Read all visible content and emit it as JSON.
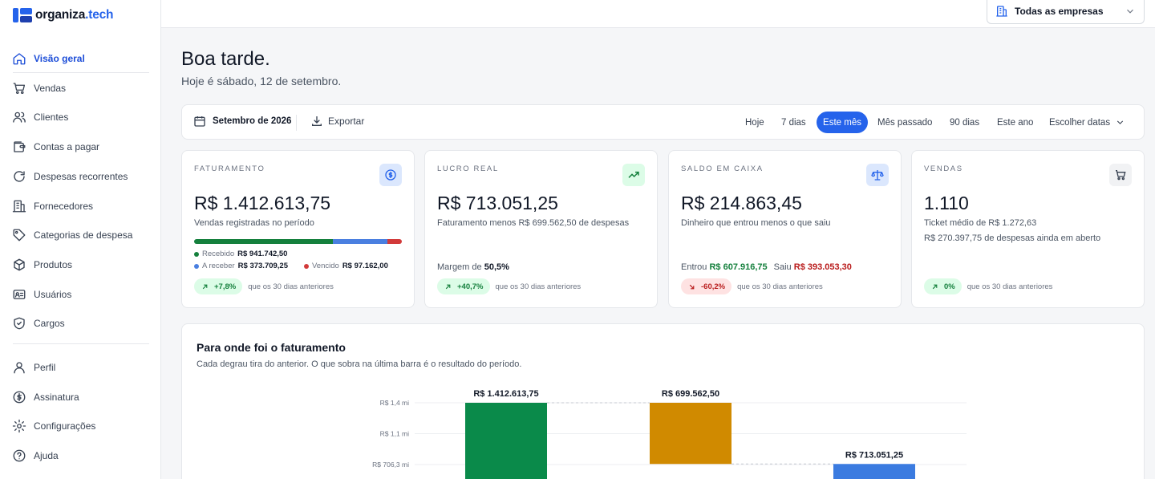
{
  "brand": {
    "name": "organiza",
    "tld": ".tech",
    "accent": "#2563eb"
  },
  "sidebar": {
    "items": [
      {
        "label": "Visão geral",
        "icon": "home-icon",
        "active": true
      },
      {
        "label": "Vendas",
        "icon": "cart-icon"
      },
      {
        "label": "Clientes",
        "icon": "users-icon"
      },
      {
        "label": "Contas a pagar",
        "icon": "wallet-icon"
      },
      {
        "label": "Despesas recorrentes",
        "icon": "refresh-icon"
      },
      {
        "label": "Fornecedores",
        "icon": "building-icon"
      },
      {
        "label": "Categorias de despesa",
        "icon": "tag-icon"
      },
      {
        "label": "Produtos",
        "icon": "box-icon"
      },
      {
        "label": "Usuários",
        "icon": "id-card-icon"
      },
      {
        "label": "Cargos",
        "icon": "shield-icon"
      }
    ],
    "bottom": [
      {
        "label": "Perfil",
        "icon": "user-icon"
      },
      {
        "label": "Assinatura",
        "icon": "dollar-circle-icon"
      },
      {
        "label": "Configurações",
        "icon": "gear-icon"
      },
      {
        "label": "Ajuda",
        "icon": "help-icon"
      }
    ]
  },
  "topbar": {
    "company_select": "Todas as empresas"
  },
  "header": {
    "greeting": "Boa tarde.",
    "date_line": "Hoje é sábado, 12 de setembro."
  },
  "filters": {
    "month": "Setembro de 2026",
    "export": "Exportar",
    "periods": [
      "Hoje",
      "7 dias",
      "Este mês",
      "Mês passado",
      "90 dias",
      "Este ano",
      "Escolher datas"
    ],
    "active_period": "Este mês"
  },
  "cards": {
    "revenue": {
      "title": "FATURAMENTO",
      "value": "R$ 1.412.613,75",
      "sub": "Vendas registradas no período",
      "legend": {
        "received_label": "Recebido",
        "received": "R$ 941.742,50",
        "receivable_label": "A receber",
        "receivable": "R$ 373.709,25",
        "overdue_label": "Vencido",
        "overdue": "R$ 97.162,00"
      },
      "bar_shares": [
        0.6667,
        0.2646,
        0.0688
      ],
      "bar_colors": [
        "#15803d",
        "#4a7fe0",
        "#d23a3a"
      ],
      "change": "+7,8%",
      "compare": "que os 30 dias anteriores"
    },
    "profit": {
      "title": "LUCRO REAL",
      "value": "R$ 713.051,25",
      "sub": "Faturamento menos R$ 699.562,50 de despesas",
      "margin_label": "Margem de",
      "margin": "50,5%",
      "change": "+40,7%",
      "compare": "que os 30 dias anteriores"
    },
    "cash": {
      "title": "SALDO EM CAIXA",
      "value": "R$ 214.863,45",
      "sub": "Dinheiro que entrou menos o que saiu",
      "in_label": "Entrou",
      "in": "R$ 607.916,75",
      "out_label": "Saiu",
      "out": "R$ 393.053,30",
      "change": "-60,2%",
      "compare": "que os 30 dias anteriores"
    },
    "sales": {
      "title": "VENDAS",
      "value": "1.110",
      "sub": "Ticket médio de R$ 1.272,63",
      "sub2": "R$ 270.397,75 de despesas ainda em aberto",
      "change": "0%",
      "compare": "que os 30 dias anteriores"
    }
  },
  "waterfall": {
    "title": "Para onde foi o faturamento",
    "subtitle": "Cada degrau tira do anterior. O que sobra na última barra é o resultado do período."
  },
  "chart_data": {
    "type": "bar",
    "subtype": "waterfall",
    "title": "Para onde foi o faturamento",
    "y_ticks": [
      {
        "label": "R$ 1,4 mi",
        "value": 1412613.75
      },
      {
        "label": "R$ 1,1 mi",
        "value": 1059460.31
      },
      {
        "label": "R$ 706,3 mi",
        "value": 706306.88
      }
    ],
    "bars": [
      {
        "label": "R$ 1.412.613,75",
        "start": 0,
        "end": 1412613.75,
        "color": "#0a8a4a"
      },
      {
        "label": "R$ 699.562,50",
        "start": 1412613.75,
        "end": 713051.25,
        "color": "#d08a00"
      },
      {
        "label": "R$ 713.051,25",
        "start": 0,
        "end": 713051.25,
        "color": "#3b7be0"
      }
    ]
  }
}
